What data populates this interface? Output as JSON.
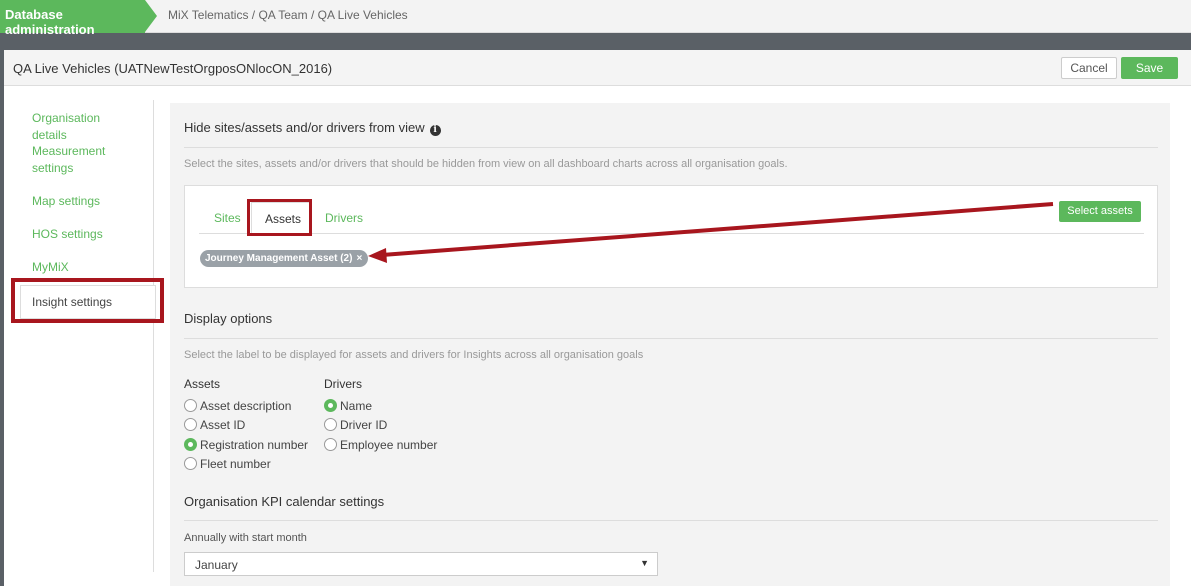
{
  "topbar": {
    "brand": "Database administration",
    "breadcrumb": "MiX Telematics / QA Team / QA Live Vehicles"
  },
  "panel": {
    "title_main": "QA Live Vehicles",
    "title_sub": "(UATNewTestOrgposONlocON_2016)",
    "cancel_label": "Cancel",
    "save_label": "Save"
  },
  "sidebar": {
    "items": [
      {
        "label": "Organisation details"
      },
      {
        "label": "Measurement settings"
      },
      {
        "label": "Map settings"
      },
      {
        "label": "HOS settings"
      },
      {
        "label": "MyMiX"
      },
      {
        "label": "Insight settings"
      }
    ]
  },
  "hide_section": {
    "title": "Hide sites/assets and/or drivers from view",
    "description": "Select the sites, assets and/or drivers that should be hidden from view on all dashboard charts across all organisation goals.",
    "tabs": [
      "Sites",
      "Assets",
      "Drivers"
    ],
    "select_button": "Select assets",
    "chip_label": "Journey Management Asset (2)",
    "chip_remove": "×"
  },
  "display_section": {
    "title": "Display options",
    "description": "Select the label to be displayed for assets and drivers for Insights across all organisation goals",
    "assets_title": "Assets",
    "assets_options": [
      {
        "label": "Asset description",
        "selected": false
      },
      {
        "label": "Asset ID",
        "selected": false
      },
      {
        "label": "Registration number",
        "selected": true
      },
      {
        "label": "Fleet number",
        "selected": false
      }
    ],
    "drivers_title": "Drivers",
    "drivers_options": [
      {
        "label": "Name",
        "selected": true
      },
      {
        "label": "Driver ID",
        "selected": false
      },
      {
        "label": "Employee number",
        "selected": false
      }
    ]
  },
  "kpi_section": {
    "title": "Organisation KPI calendar settings",
    "field_label": "Annually with start month",
    "selected_value": "January"
  },
  "colors": {
    "accent": "#5cb85c",
    "annotation": "#a8161e"
  }
}
